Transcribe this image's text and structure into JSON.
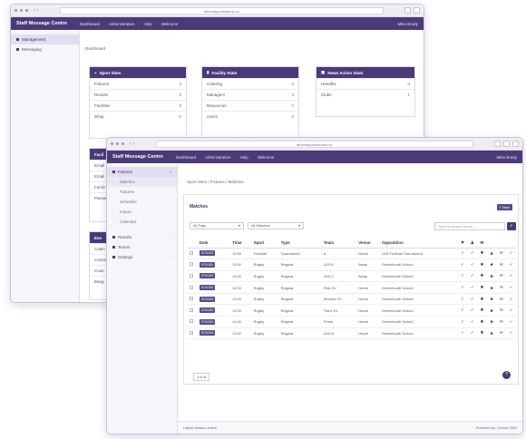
{
  "back_window": {
    "url": "athenasportsteams.co",
    "app": {
      "brand": "Staff Message Centre",
      "nav": [
        "Dashboard",
        "Administration",
        "Help",
        "Welcome"
      ],
      "user": "Mike Brady"
    },
    "sidebar": [
      {
        "label": "Management",
        "active": true
      },
      {
        "label": "Messaging",
        "active": false
      }
    ],
    "breadcrumb": "Dashboard",
    "cards": [
      {
        "title": "Sport Sites",
        "rows": [
          {
            "label": "Fixtures",
            "count": "3"
          },
          {
            "label": "Results",
            "count": "0"
          },
          {
            "label": "Facilities",
            "count": "5"
          },
          {
            "label": "Shop",
            "count": "0"
          }
        ]
      },
      {
        "title": "Facility Stats",
        "rows": [
          {
            "label": "Catering",
            "count": "0"
          },
          {
            "label": "Managers",
            "count": "4"
          },
          {
            "label": "Resources",
            "count": "0"
          },
          {
            "label": "Users",
            "count": "6"
          }
        ]
      },
      {
        "title": "News Action Stats",
        "rows": [
          {
            "label": "Handles",
            "count": "0"
          },
          {
            "label": "Clubs",
            "count": "1"
          }
        ]
      }
    ],
    "lower_cards": [
      {
        "title": "Facil",
        "rows": [
          "Email",
          "Email",
          "Facilit",
          "Passw"
        ]
      },
      {
        "title": "Eve",
        "rows": [
          "Calen",
          "Comm",
          "Coun",
          "Bang"
        ]
      }
    ]
  },
  "front_window": {
    "url": "athenasportsteams.co",
    "app": {
      "brand": "Staff Message Centre",
      "nav": [
        "Dashboard",
        "Administration",
        "Help",
        "Welcome"
      ],
      "user": "Mike Brady"
    },
    "sidebar": [
      {
        "label": "Fixtures",
        "level": "top",
        "active": true
      },
      {
        "label": "Matches",
        "level": "sub",
        "active": true
      },
      {
        "label": "Fixtures",
        "level": "sub",
        "active": false
      },
      {
        "label": "Schedule",
        "level": "sub",
        "active": false
      },
      {
        "label": "Import",
        "level": "sub",
        "active": false
      },
      {
        "label": "Calendar",
        "level": "sub",
        "active": false
      },
      {
        "label": "Results",
        "level": "top",
        "active": false
      },
      {
        "label": "Teams",
        "level": "top",
        "active": false
      },
      {
        "label": "Settings",
        "level": "top",
        "active": false
      }
    ],
    "breadcrumb": [
      "Sport Sites",
      "Fixtures",
      "Matches"
    ],
    "section_title": "Matches",
    "new_button": "+ New",
    "filters": {
      "type_select": "All Tags",
      "match_select": "All Matches",
      "search_placeholder": "Type to search sports"
    },
    "table": {
      "columns": [
        "Date",
        "Time",
        "Sport",
        "Type",
        "Team",
        "Venue",
        "Opposition"
      ],
      "icon_columns": [
        "pin-icon",
        "person-icon",
        "message-icon"
      ],
      "rows": [
        {
          "date": "07/10/20",
          "time": "10:00",
          "sport": "Football",
          "type": "Tournament",
          "team": "A",
          "venue": "Home",
          "opposition": "U15 Football Tournament"
        },
        {
          "date": "07/10/20",
          "time": "11:00",
          "sport": "Rugby",
          "type": "Regular",
          "team": "U15 A",
          "venue": "Away",
          "opposition": "Greenhouth School"
        },
        {
          "date": "07/10/20",
          "time": "11:00",
          "sport": "Rugby",
          "type": "Regular",
          "team": "U15 C",
          "venue": "Away",
          "opposition": "Greenhouth School"
        },
        {
          "date": "07/10/20",
          "time": "11:00",
          "sport": "Rugby",
          "type": "Regular",
          "team": "First XV",
          "venue": "Home",
          "opposition": "Greenhouth School"
        },
        {
          "date": "07/10/20",
          "time": "11:00",
          "sport": "Rugby",
          "type": "Regular",
          "team": "Second XV",
          "venue": "Home",
          "opposition": "Greenhouth School"
        },
        {
          "date": "07/10/20",
          "time": "11:00",
          "sport": "Rugby",
          "type": "Regular",
          "team": "Third XV",
          "venue": "Home",
          "opposition": "Greenhouth School"
        },
        {
          "date": "07/10/20",
          "time": "11:00",
          "sport": "Rugby",
          "type": "Regular",
          "team": "Prime",
          "venue": "Home",
          "opposition": "Greenhouth School"
        },
        {
          "date": "07/10/20",
          "time": "11:00",
          "sport": "Rugby",
          "type": "Regular",
          "team": "U15 B",
          "venue": "Home",
          "opposition": "Greenhouth School"
        }
      ]
    },
    "pager_label": "1 to 8",
    "help_icon": "?",
    "footer": {
      "left": "Latest Version Active",
      "right": "Powered by: Cronin CMS"
    },
    "colors": {
      "accent": "#4a3a78",
      "badge": "#5b4a8c"
    }
  }
}
